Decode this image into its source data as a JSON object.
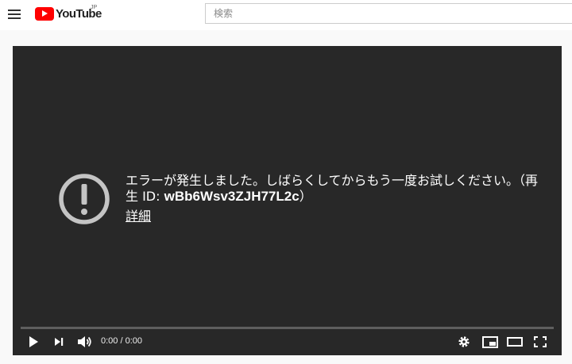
{
  "header": {
    "logo_text": "YouTube",
    "logo_region": "JP",
    "search": {
      "placeholder": "検索",
      "value": ""
    }
  },
  "player": {
    "error": {
      "message": "エラーが発生しました。しばらくしてからもう一度お試しください。（再生 ID: ",
      "playback_id": "wBb6Wsv3ZJH77L2c",
      "message_end": "）",
      "more_link": "詳細"
    },
    "time_display": "0:00 / 0:00",
    "progress": 0,
    "icons": [
      "play-icon",
      "next-icon",
      "volume-icon",
      "settings-icon",
      "miniplayer-icon",
      "theater-icon",
      "fullscreen-icon"
    ]
  },
  "colors": {
    "brand_red": "#ff0000",
    "player_bg": "#282828",
    "page_bg": "#f9f9f9"
  }
}
